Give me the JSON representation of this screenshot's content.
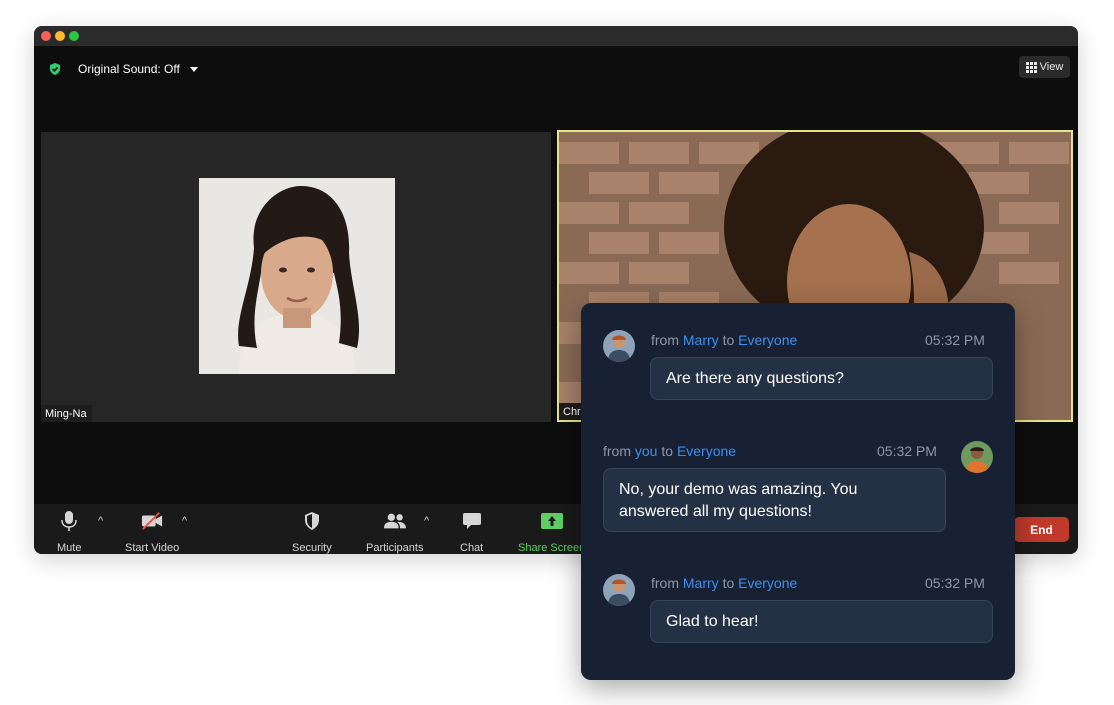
{
  "window": {
    "sound_label": "Original Sound: Off",
    "view_label": "View"
  },
  "participants": [
    {
      "name": "Ming-Na"
    },
    {
      "name": "Chri"
    }
  ],
  "toolbar": {
    "mute": "Mute",
    "start_video": "Start Video",
    "security": "Security",
    "participants": "Participants",
    "chat": "Chat",
    "share_screen": "Share Screen",
    "end": "End"
  },
  "chat": {
    "messages": [
      {
        "from_word": "from",
        "sender": "Marry",
        "to_word": "to",
        "recipient": "Everyone",
        "time": "05:32 PM",
        "text": "Are there any questions?"
      },
      {
        "from_word": "from",
        "sender": "you",
        "to_word": "to",
        "recipient": "Everyone",
        "time": "05:32 PM",
        "text": "No, your demo was amazing. You answered all my questions!"
      },
      {
        "from_word": "from",
        "sender": "Marry",
        "to_word": "to",
        "recipient": "Everyone",
        "time": "05:32 PM",
        "text": "Glad to hear!"
      }
    ]
  },
  "colors": {
    "accent_blue": "#3d8ff0",
    "end_red": "#c0392b",
    "share_green": "#5fcf65",
    "active_speaker_border": "#e7e488"
  }
}
